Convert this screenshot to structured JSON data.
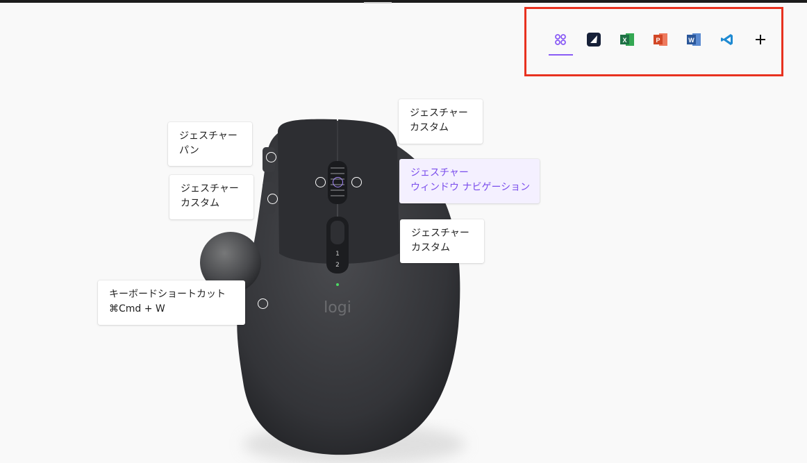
{
  "app_switcher": {
    "apps": [
      {
        "name": "all-apps",
        "label": "",
        "color": "#8a5cf6"
      },
      {
        "name": "app-icon-1",
        "label": "",
        "color": "#1f2b4a"
      },
      {
        "name": "excel",
        "label": "X",
        "color": "#1e7145"
      },
      {
        "name": "powerpoint",
        "label": "P",
        "color": "#d24726"
      },
      {
        "name": "word",
        "label": "W",
        "color": "#2b579a"
      },
      {
        "name": "vscode",
        "label": "",
        "color": "#1f8ad2"
      },
      {
        "name": "add",
        "label": "+",
        "color": "#111111"
      }
    ],
    "highlight_color": "#e8321f",
    "active_color": "#8a5cf6"
  },
  "mouse": {
    "brand_text": "logi",
    "dpi_marks": [
      "1",
      "2"
    ]
  },
  "callouts": {
    "top_left": {
      "line1": "ジェスチャー",
      "line2": "パン"
    },
    "mid_left": {
      "line1": "ジェスチャー",
      "line2": "カスタム"
    },
    "top_right": {
      "line1": "ジェスチャー",
      "line2": "カスタム"
    },
    "middle_right": {
      "line1": "ジェスチャー",
      "line2": "ウィンドウ ナビゲーション"
    },
    "lower_right": {
      "line1": "ジェスチャー",
      "line2": "カスタム"
    },
    "bottom_left": {
      "line1": "キーボードショートカット",
      "line2": "⌘Cmd + W"
    }
  }
}
